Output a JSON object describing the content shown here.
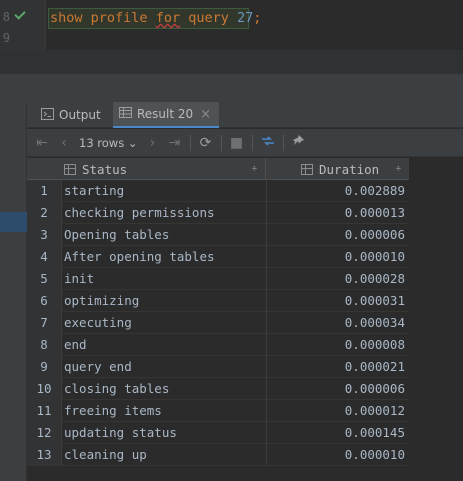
{
  "editor": {
    "line_numbers": [
      "8",
      "9"
    ],
    "code": {
      "t1": "show",
      "t2": " ",
      "t3": "profile",
      "t4": " ",
      "t5": "for",
      "t6": " ",
      "t7": "query",
      "t8": " ",
      "t9": "27",
      "t10": ";"
    }
  },
  "tabs": {
    "output_label": "Output",
    "result_label": "Result 20",
    "close_glyph": "×"
  },
  "toolbar": {
    "rows_label": "13 rows",
    "rows_caret": "⌄"
  },
  "grid": {
    "columns": [
      "Status",
      "Duration"
    ],
    "sort_glyph": "÷",
    "rows": [
      {
        "n": "1",
        "status": "starting",
        "duration": "0.002889"
      },
      {
        "n": "2",
        "status": "checking permissions",
        "duration": "0.000013"
      },
      {
        "n": "3",
        "status": "Opening tables",
        "duration": "0.000006"
      },
      {
        "n": "4",
        "status": "After opening tables",
        "duration": "0.000010"
      },
      {
        "n": "5",
        "status": "init",
        "duration": "0.000028"
      },
      {
        "n": "6",
        "status": "optimizing",
        "duration": "0.000031"
      },
      {
        "n": "7",
        "status": "executing",
        "duration": "0.000034"
      },
      {
        "n": "8",
        "status": "end",
        "duration": "0.000008"
      },
      {
        "n": "9",
        "status": "query end",
        "duration": "0.000021"
      },
      {
        "n": "10",
        "status": "closing tables",
        "duration": "0.000006"
      },
      {
        "n": "11",
        "status": "freeing items",
        "duration": "0.000012"
      },
      {
        "n": "12",
        "status": "updating status",
        "duration": "0.000145"
      },
      {
        "n": "13",
        "status": "cleaning up",
        "duration": "0.000010"
      }
    ]
  },
  "colors": {
    "accent": "#4a88c7",
    "success": "#59a869",
    "keyword": "#cc7832",
    "number": "#6897bb"
  },
  "icons": {
    "run_status": "check-icon",
    "output_tab": "console-icon",
    "result_tab": "table-icon",
    "first": "first-page-icon",
    "prev": "prev-page-icon",
    "next": "next-page-icon",
    "last": "last-page-icon",
    "refresh": "refresh-icon",
    "stop": "stop-icon",
    "compare": "compare-icon",
    "pin": "pin-icon"
  }
}
